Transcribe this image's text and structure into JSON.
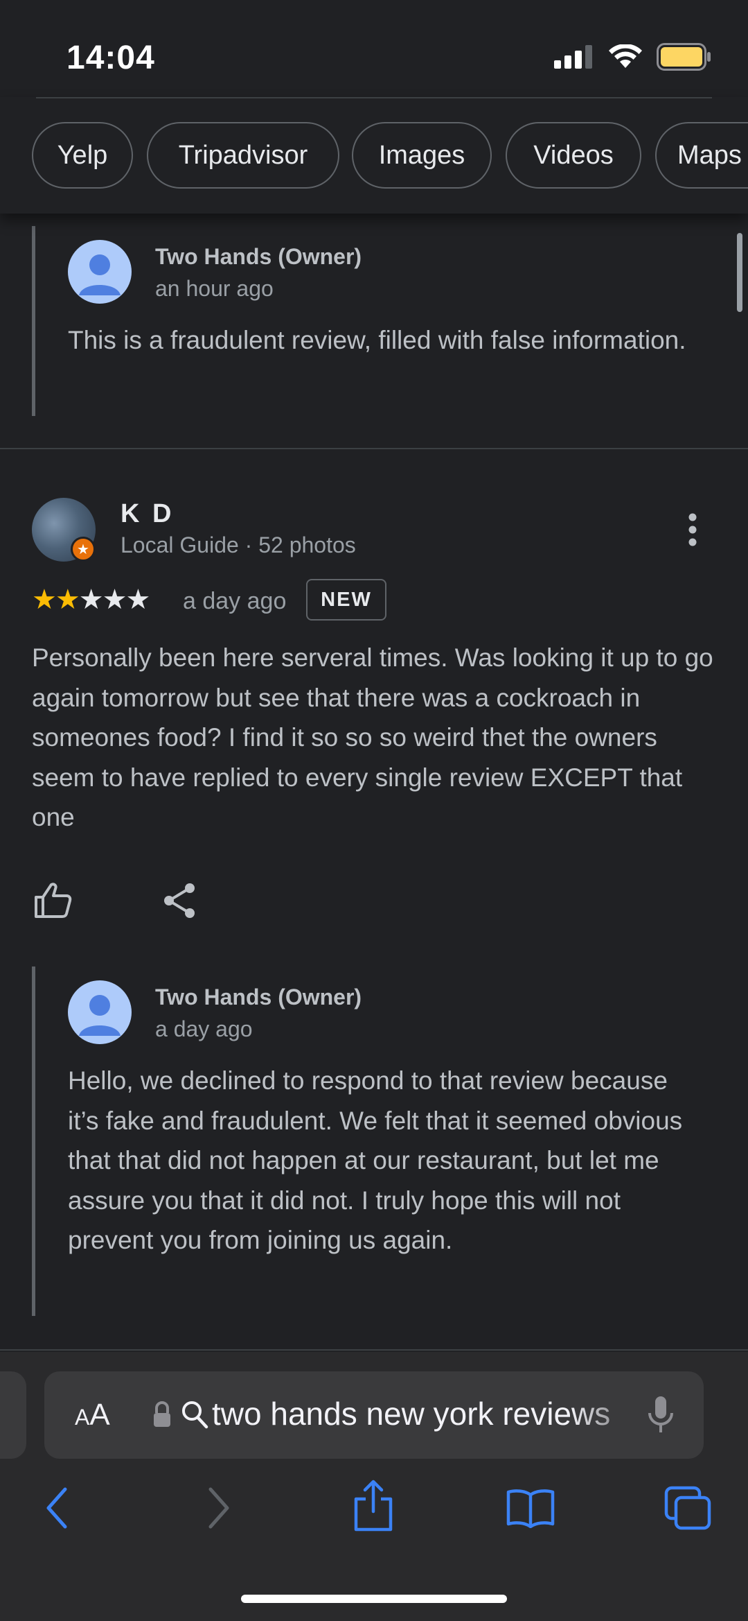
{
  "status_bar": {
    "time": "14:04"
  },
  "chips": [
    {
      "label": "Yelp"
    },
    {
      "label": "Tripadvisor"
    },
    {
      "label": "Images"
    },
    {
      "label": "Videos"
    },
    {
      "label": "Maps"
    }
  ],
  "reply_1": {
    "name": "Two Hands (Owner)",
    "time": "an hour ago",
    "text": "This is a fraudulent review, filled with false information."
  },
  "review": {
    "name": "K D",
    "meta": "Local Guide · 52 photos",
    "rating": 2,
    "max_rating": 5,
    "time": "a day ago",
    "badge": "NEW",
    "text": "Personally been here serveral times. Was looking it up to go again tomorrow but see that there was a cockroach in someones food? I find it so so so weird thet the owners seem to have replied to every single review EXCEPT that one"
  },
  "reply_2": {
    "name": "Two Hands (Owner)",
    "time": "a day ago",
    "text": "Hello, we declined to respond to that review because it’s fake and fraudulent. We felt that it seemed obvious that that did not happen at our restaurant, but let me assure you that it did not. I truly hope this will not prevent you from joining us again."
  },
  "browser": {
    "aa_label": "AA",
    "url": "two hands new york reviews"
  },
  "colors": {
    "background": "#202124",
    "star": "#fbbc04",
    "link": "#3b82f6",
    "local_guide_badge": "#e8710a"
  }
}
